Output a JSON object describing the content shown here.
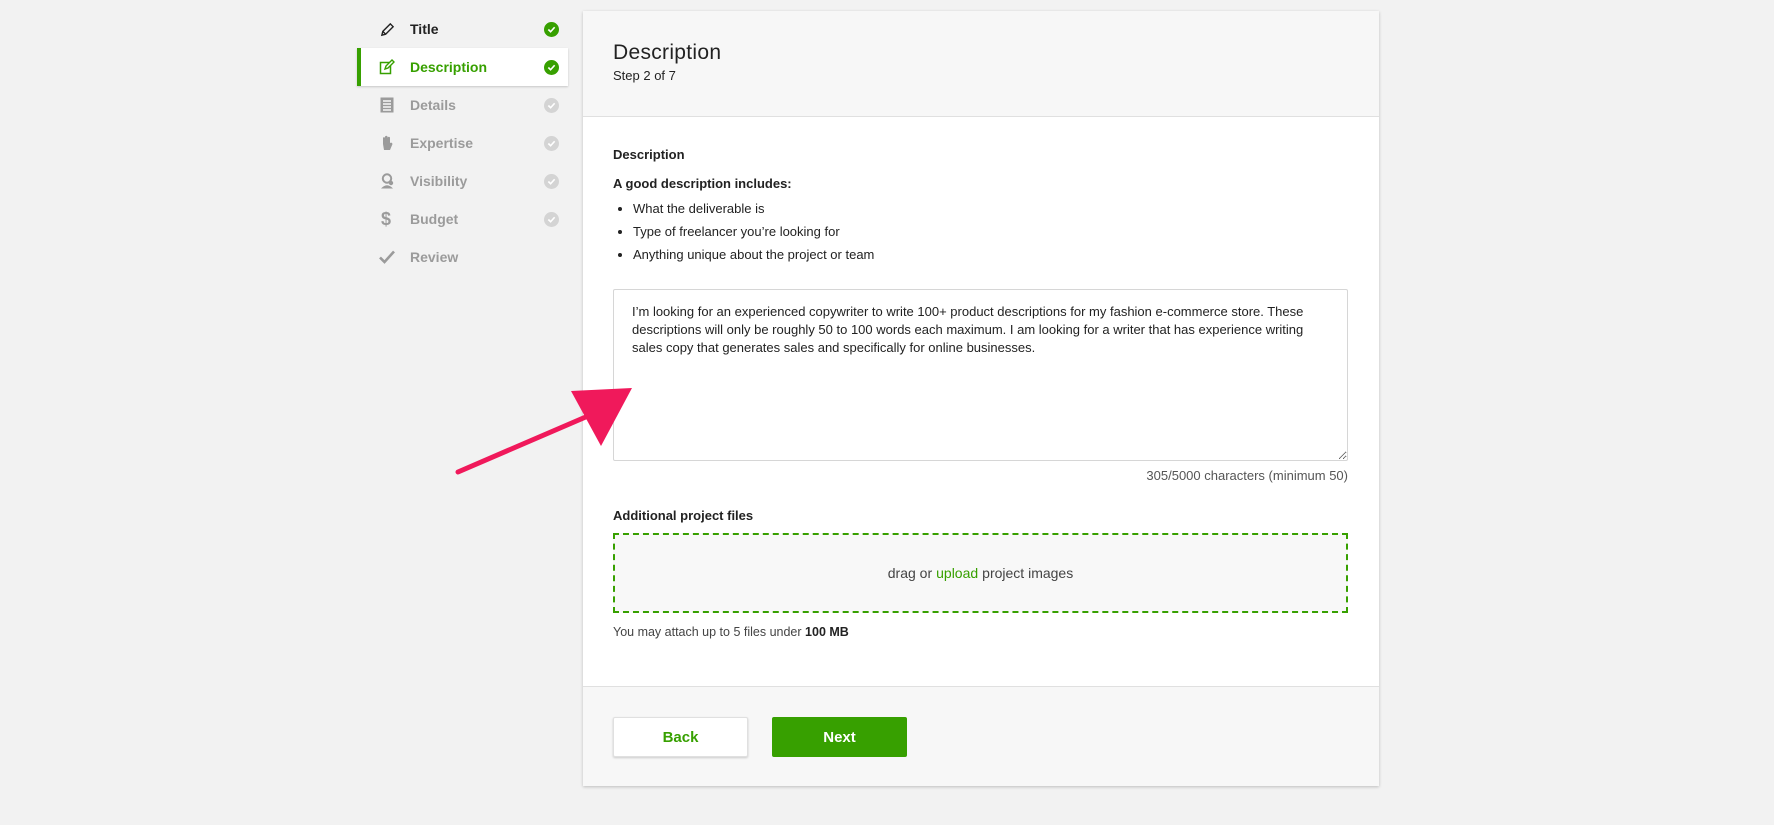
{
  "sidebar": {
    "items": [
      {
        "label": "Title",
        "icon": "pencil-icon",
        "state": "done"
      },
      {
        "label": "Description",
        "icon": "edit-icon",
        "state": "active"
      },
      {
        "label": "Details",
        "icon": "list-icon",
        "state": "pending"
      },
      {
        "label": "Expertise",
        "icon": "hand-icon",
        "state": "pending"
      },
      {
        "label": "Visibility",
        "icon": "user-icon",
        "state": "pending"
      },
      {
        "label": "Budget",
        "icon": "dollar-icon",
        "state": "pending"
      },
      {
        "label": "Review",
        "icon": "checkmark-icon",
        "state": "pending"
      }
    ]
  },
  "header": {
    "title": "Description",
    "step": "Step 2 of 7"
  },
  "description": {
    "label": "Description",
    "tips_heading": "A good description includes:",
    "tips": [
      "What the deliverable is",
      "Type of freelancer you’re looking for",
      "Anything unique about the project or team"
    ],
    "value": "I’m looking for an experienced copywriter to write 100+ product descriptions for my fashion e-commerce store. These descriptions will only be roughly 50 to 100 words each maximum. I am looking for a writer that has experience writing sales copy that generates sales and specifically for online businesses.",
    "char_count": "305/5000 characters (minimum 50)"
  },
  "files": {
    "label": "Additional project files",
    "drop_prefix": "drag or",
    "upload_link": "upload",
    "drop_suffix": "project images",
    "note_prefix": "You may attach up to 5 files under",
    "note_limit": "100 MB"
  },
  "footer": {
    "back_label": "Back",
    "next_label": "Next"
  },
  "colors": {
    "accent": "#37a000",
    "annotation_arrow": "#f0195b"
  }
}
